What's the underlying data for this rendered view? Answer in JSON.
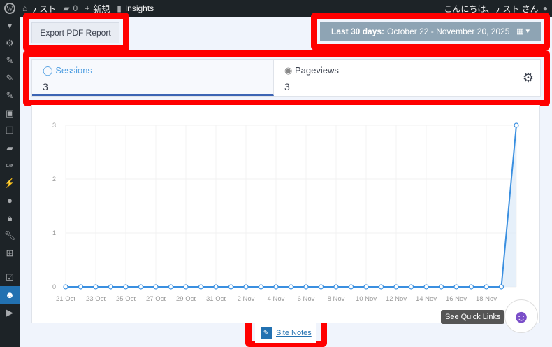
{
  "topbar": {
    "site": "テスト",
    "comments": "0",
    "new": "新規",
    "insights": "Insights",
    "greeting": "こんにちは、テスト さん"
  },
  "toolbar": {
    "export_label": "Export PDF Report",
    "date_prefix": "Last 30 days:",
    "date_range": "October 22 - November 20, 2025"
  },
  "tabs": [
    {
      "label": "Sessions",
      "value": "3",
      "icon": "user-circle-icon",
      "active": true
    },
    {
      "label": "Pageviews",
      "value": "3",
      "icon": "eye-icon"
    }
  ],
  "site_notes": "Site Notes",
  "quick_links": "See Quick Links",
  "colors": {
    "line": "#3a8fe0",
    "active_tab": "#509fe2",
    "date_bg": "#8ea4b4"
  },
  "chart_data": {
    "type": "line",
    "x_tick_labels": [
      "21 Oct",
      "23 Oct",
      "25 Oct",
      "27 Oct",
      "29 Oct",
      "31 Oct",
      "2 Nov",
      "4 Nov",
      "6 Nov",
      "8 Nov",
      "10 Nov",
      "12 Nov",
      "14 Nov",
      "16 Nov",
      "18 Nov"
    ],
    "x": [
      "21 Oct",
      "22 Oct",
      "23 Oct",
      "24 Oct",
      "25 Oct",
      "26 Oct",
      "27 Oct",
      "28 Oct",
      "29 Oct",
      "30 Oct",
      "31 Oct",
      "1 Nov",
      "2 Nov",
      "3 Nov",
      "4 Nov",
      "5 Nov",
      "6 Nov",
      "7 Nov",
      "8 Nov",
      "9 Nov",
      "10 Nov",
      "11 Nov",
      "12 Nov",
      "13 Nov",
      "14 Nov",
      "15 Nov",
      "16 Nov",
      "17 Nov",
      "18 Nov",
      "19 Nov",
      "20 Nov"
    ],
    "values": [
      0,
      0,
      0,
      0,
      0,
      0,
      0,
      0,
      0,
      0,
      0,
      0,
      0,
      0,
      0,
      0,
      0,
      0,
      0,
      0,
      0,
      0,
      0,
      0,
      0,
      0,
      0,
      0,
      0,
      0,
      3
    ],
    "y_ticks": [
      "0",
      "1",
      "2",
      "3"
    ],
    "ylim": [
      0,
      3
    ],
    "grid": true
  }
}
